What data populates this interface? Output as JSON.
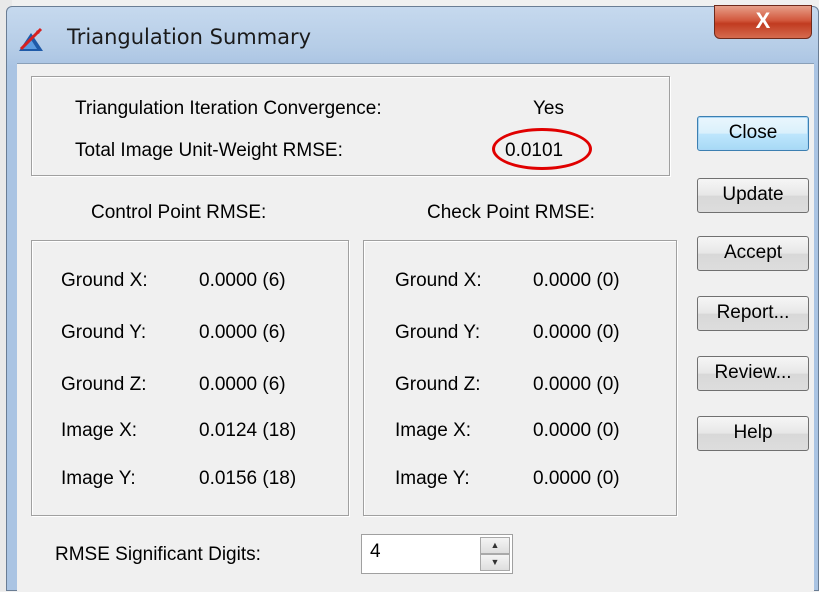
{
  "window": {
    "title": "Triangulation Summary",
    "close_glyph": "X"
  },
  "summary": {
    "convergence_label": "Triangulation Iteration Convergence:",
    "convergence_value": "Yes",
    "rmse_label": "Total Image Unit-Weight RMSE:",
    "rmse_value": "0.0101"
  },
  "control": {
    "heading": "Control Point RMSE:",
    "rows": [
      {
        "label": "Ground X:",
        "value": "0.0000 (6)"
      },
      {
        "label": "Ground Y:",
        "value": "0.0000 (6)"
      },
      {
        "label": "Ground Z:",
        "value": "0.0000 (6)"
      },
      {
        "label": "Image X:",
        "value": "0.0124 (18)"
      },
      {
        "label": "Image Y:",
        "value": "0.0156 (18)"
      }
    ]
  },
  "check": {
    "heading": "Check Point RMSE:",
    "rows": [
      {
        "label": "Ground X:",
        "value": "0.0000 (0)"
      },
      {
        "label": "Ground Y:",
        "value": "0.0000 (0)"
      },
      {
        "label": "Ground Z:",
        "value": "0.0000 (0)"
      },
      {
        "label": "Image X:",
        "value": "0.0000 (0)"
      },
      {
        "label": "Image Y:",
        "value": "0.0000 (0)"
      }
    ]
  },
  "digits": {
    "label": "RMSE Significant Digits:",
    "value": "4"
  },
  "buttons": {
    "close": "Close",
    "update": "Update",
    "accept": "Accept",
    "report": "Report...",
    "review": "Review...",
    "help": "Help"
  },
  "icons": {
    "app": "triangulation-app-icon",
    "spin_up": "spin-up-arrow-icon",
    "spin_down": "spin-down-arrow-icon"
  },
  "colors": {
    "highlight_circle": "#e00000",
    "close_button": "#c13b20"
  }
}
